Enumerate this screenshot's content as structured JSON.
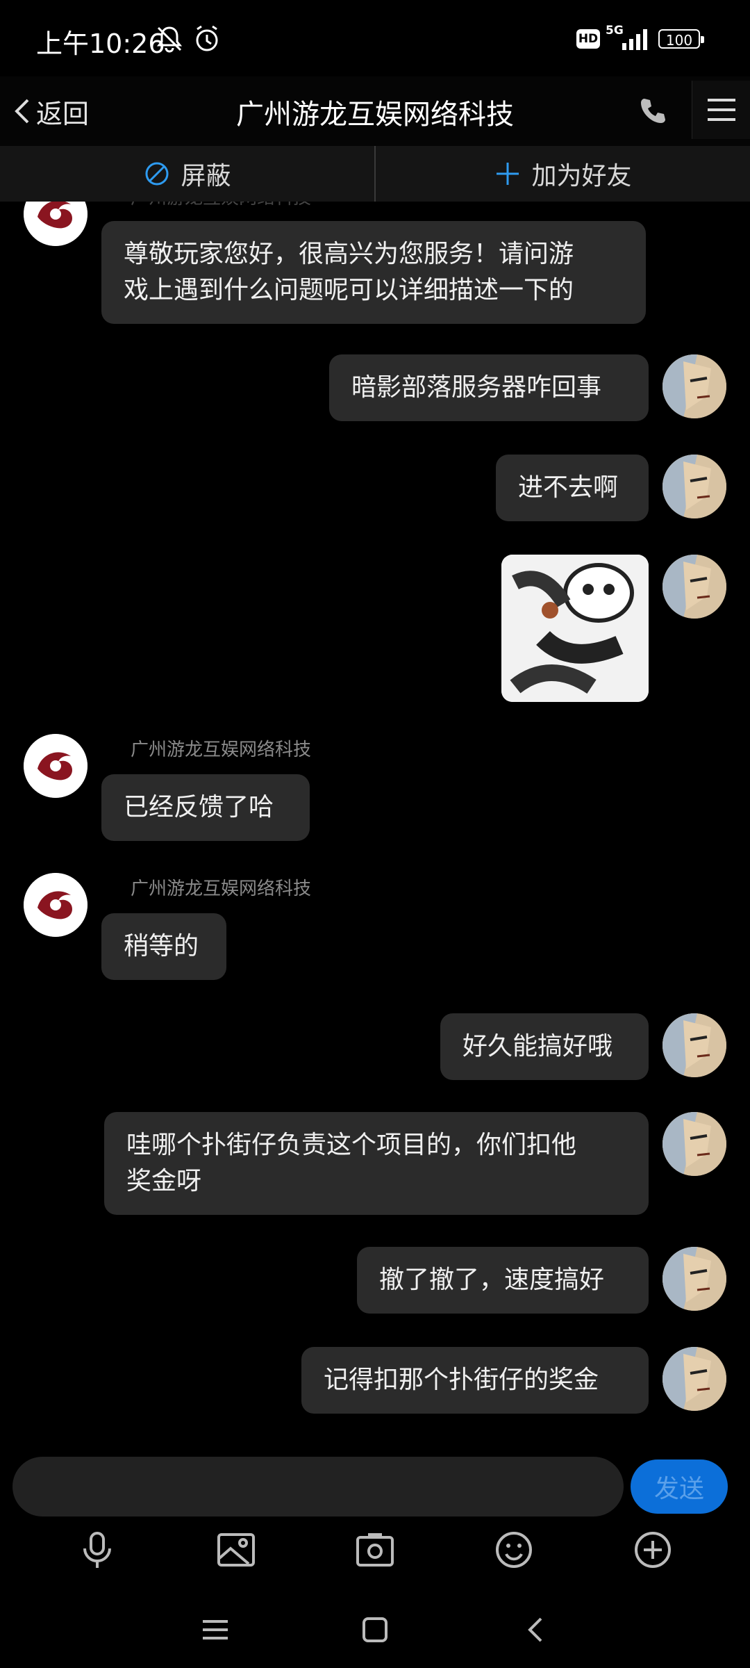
{
  "status_bar": {
    "time": "上午10:26",
    "hd": "HD",
    "network": "5G",
    "battery": "100"
  },
  "header": {
    "back_label": "返回",
    "title": "广州游龙互娱网络科技"
  },
  "actions": {
    "block_label": "屏蔽",
    "add_friend_label": "加为好友"
  },
  "messages": [
    {
      "from": "company",
      "sender": "广州游龙互娱网络科技",
      "text_lines": [
        "尊敬玩家您好，很高兴为您服务！请问游",
        "戏上遇到什么问题呢可以详细描述一下的"
      ]
    },
    {
      "from": "user",
      "text": "暗影部落服务器咋回事"
    },
    {
      "from": "user",
      "text": "进不去啊"
    },
    {
      "from": "user",
      "type": "sticker"
    },
    {
      "from": "company",
      "sender": "广州游龙互娱网络科技",
      "text": "已经反馈了哈"
    },
    {
      "from": "company",
      "sender": "广州游龙互娱网络科技",
      "text": "稍等的"
    },
    {
      "from": "user",
      "text": "好久能搞好哦"
    },
    {
      "from": "user",
      "text_lines": [
        "哇哪个扑街仔负责这个项目的，你们扣他",
        "奖金呀"
      ]
    },
    {
      "from": "user",
      "text": "撤了撤了，速度搞好"
    },
    {
      "from": "user",
      "text": "记得扣那个扑街仔的奖金"
    }
  ],
  "input": {
    "value": "",
    "send_label": "发送"
  },
  "colors": {
    "background": "#000000",
    "bubble": "#2b2b2b",
    "accent": "#0c6fd9"
  },
  "icons": {
    "toolbar": [
      "microphone-icon",
      "image-icon",
      "camera-icon",
      "emoji-icon",
      "plus-icon"
    ],
    "system": [
      "recent-apps-icon",
      "home-icon",
      "back-icon"
    ]
  }
}
